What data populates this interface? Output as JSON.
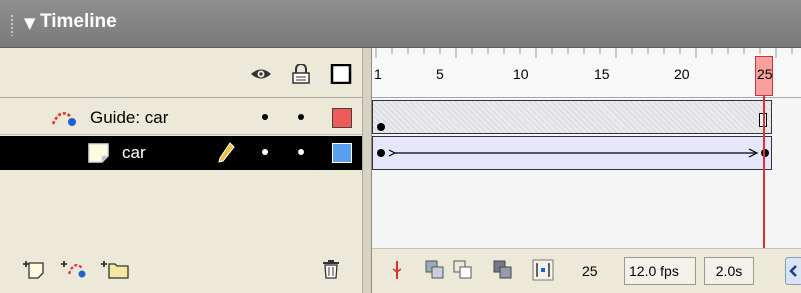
{
  "panel": {
    "title": "Timeline",
    "collapse_icon": "triangle-down-icon"
  },
  "layer_header": {
    "icons": [
      "eye-icon",
      "lock-icon",
      "outline-icon"
    ]
  },
  "layers": [
    {
      "name": "Guide: car",
      "type": "motion-guide",
      "icon": "motion-guide-icon",
      "outline_color": "#f05a5a",
      "selected": false
    },
    {
      "name": "car",
      "type": "normal",
      "icon": "layer-icon",
      "edit_icon": "pencil-icon",
      "outline_color": "#5aa0f0",
      "selected": true
    }
  ],
  "layer_footer": {
    "icons": [
      "insert-layer-icon",
      "add-motion-guide-icon",
      "insert-folder-icon",
      "delete-layer-icon"
    ]
  },
  "ruler": {
    "labels": [
      "1",
      "5",
      "10",
      "15",
      "20"
    ],
    "current_frame_label": "25"
  },
  "status": {
    "current_frame": "25",
    "frame_rate": "12.0 fps",
    "elapsed_time": "2.0s",
    "buttons": [
      "center-frame-icon",
      "onion-skin-icon",
      "onion-skin-outlines-icon",
      "edit-multiple-frames-icon",
      "modify-onion-markers-icon"
    ]
  },
  "colors": {
    "titlebar": "#858585",
    "selected_row": "#000000",
    "playhead": "#e03030",
    "tween_fill": "#e6e6fa"
  }
}
